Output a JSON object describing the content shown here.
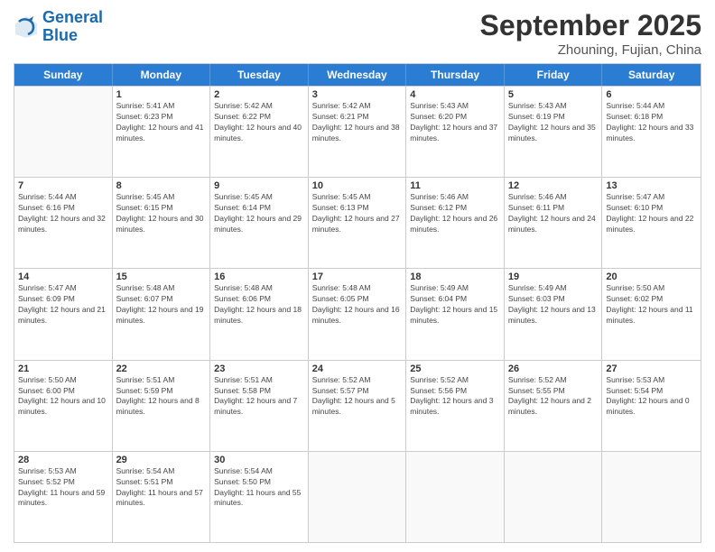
{
  "header": {
    "logo_line1": "General",
    "logo_line2": "Blue",
    "month": "September 2025",
    "location": "Zhouning, Fujian, China"
  },
  "weekdays": [
    "Sunday",
    "Monday",
    "Tuesday",
    "Wednesday",
    "Thursday",
    "Friday",
    "Saturday"
  ],
  "weeks": [
    [
      {
        "day": "",
        "empty": true
      },
      {
        "day": "1",
        "sunrise": "5:41 AM",
        "sunset": "6:23 PM",
        "daylight": "12 hours and 41 minutes."
      },
      {
        "day": "2",
        "sunrise": "5:42 AM",
        "sunset": "6:22 PM",
        "daylight": "12 hours and 40 minutes."
      },
      {
        "day": "3",
        "sunrise": "5:42 AM",
        "sunset": "6:21 PM",
        "daylight": "12 hours and 38 minutes."
      },
      {
        "day": "4",
        "sunrise": "5:43 AM",
        "sunset": "6:20 PM",
        "daylight": "12 hours and 37 minutes."
      },
      {
        "day": "5",
        "sunrise": "5:43 AM",
        "sunset": "6:19 PM",
        "daylight": "12 hours and 35 minutes."
      },
      {
        "day": "6",
        "sunrise": "5:44 AM",
        "sunset": "6:18 PM",
        "daylight": "12 hours and 33 minutes."
      }
    ],
    [
      {
        "day": "7",
        "sunrise": "5:44 AM",
        "sunset": "6:16 PM",
        "daylight": "12 hours and 32 minutes."
      },
      {
        "day": "8",
        "sunrise": "5:45 AM",
        "sunset": "6:15 PM",
        "daylight": "12 hours and 30 minutes."
      },
      {
        "day": "9",
        "sunrise": "5:45 AM",
        "sunset": "6:14 PM",
        "daylight": "12 hours and 29 minutes."
      },
      {
        "day": "10",
        "sunrise": "5:45 AM",
        "sunset": "6:13 PM",
        "daylight": "12 hours and 27 minutes."
      },
      {
        "day": "11",
        "sunrise": "5:46 AM",
        "sunset": "6:12 PM",
        "daylight": "12 hours and 26 minutes."
      },
      {
        "day": "12",
        "sunrise": "5:46 AM",
        "sunset": "6:11 PM",
        "daylight": "12 hours and 24 minutes."
      },
      {
        "day": "13",
        "sunrise": "5:47 AM",
        "sunset": "6:10 PM",
        "daylight": "12 hours and 22 minutes."
      }
    ],
    [
      {
        "day": "14",
        "sunrise": "5:47 AM",
        "sunset": "6:09 PM",
        "daylight": "12 hours and 21 minutes."
      },
      {
        "day": "15",
        "sunrise": "5:48 AM",
        "sunset": "6:07 PM",
        "daylight": "12 hours and 19 minutes."
      },
      {
        "day": "16",
        "sunrise": "5:48 AM",
        "sunset": "6:06 PM",
        "daylight": "12 hours and 18 minutes."
      },
      {
        "day": "17",
        "sunrise": "5:48 AM",
        "sunset": "6:05 PM",
        "daylight": "12 hours and 16 minutes."
      },
      {
        "day": "18",
        "sunrise": "5:49 AM",
        "sunset": "6:04 PM",
        "daylight": "12 hours and 15 minutes."
      },
      {
        "day": "19",
        "sunrise": "5:49 AM",
        "sunset": "6:03 PM",
        "daylight": "12 hours and 13 minutes."
      },
      {
        "day": "20",
        "sunrise": "5:50 AM",
        "sunset": "6:02 PM",
        "daylight": "12 hours and 11 minutes."
      }
    ],
    [
      {
        "day": "21",
        "sunrise": "5:50 AM",
        "sunset": "6:00 PM",
        "daylight": "12 hours and 10 minutes."
      },
      {
        "day": "22",
        "sunrise": "5:51 AM",
        "sunset": "5:59 PM",
        "daylight": "12 hours and 8 minutes."
      },
      {
        "day": "23",
        "sunrise": "5:51 AM",
        "sunset": "5:58 PM",
        "daylight": "12 hours and 7 minutes."
      },
      {
        "day": "24",
        "sunrise": "5:52 AM",
        "sunset": "5:57 PM",
        "daylight": "12 hours and 5 minutes."
      },
      {
        "day": "25",
        "sunrise": "5:52 AM",
        "sunset": "5:56 PM",
        "daylight": "12 hours and 3 minutes."
      },
      {
        "day": "26",
        "sunrise": "5:52 AM",
        "sunset": "5:55 PM",
        "daylight": "12 hours and 2 minutes."
      },
      {
        "day": "27",
        "sunrise": "5:53 AM",
        "sunset": "5:54 PM",
        "daylight": "12 hours and 0 minutes."
      }
    ],
    [
      {
        "day": "28",
        "sunrise": "5:53 AM",
        "sunset": "5:52 PM",
        "daylight": "11 hours and 59 minutes."
      },
      {
        "day": "29",
        "sunrise": "5:54 AM",
        "sunset": "5:51 PM",
        "daylight": "11 hours and 57 minutes."
      },
      {
        "day": "30",
        "sunrise": "5:54 AM",
        "sunset": "5:50 PM",
        "daylight": "11 hours and 55 minutes."
      },
      {
        "day": "",
        "empty": true
      },
      {
        "day": "",
        "empty": true
      },
      {
        "day": "",
        "empty": true
      },
      {
        "day": "",
        "empty": true
      }
    ]
  ]
}
